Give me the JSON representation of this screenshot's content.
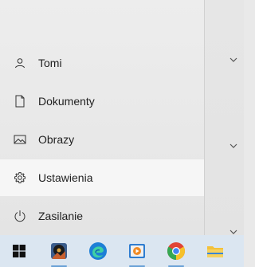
{
  "start_menu": {
    "items": [
      {
        "label": "Tomi",
        "icon": "user-icon",
        "active": false
      },
      {
        "label": "Dokumenty",
        "icon": "document-icon",
        "active": false
      },
      {
        "label": "Obrazy",
        "icon": "pictures-icon",
        "active": false
      },
      {
        "label": "Ustawienia",
        "icon": "gear-icon",
        "active": true
      },
      {
        "label": "Zasilanie",
        "icon": "power-icon",
        "active": false
      }
    ]
  },
  "right_panel": {
    "chevrons": [
      "chevron-down-icon",
      "chevron-down-icon",
      "chevron-down-icon"
    ]
  },
  "taskbar": {
    "icons": [
      "windows-start-icon",
      "media-app-icon",
      "edge-icon",
      "video-app-icon",
      "chrome-icon",
      "file-explorer-icon"
    ]
  },
  "colors": {
    "taskbar_bg": "#dbe6f1",
    "hover_item_bg": "#f6f6f6",
    "windows_blue": "#1f6fb4",
    "edge_blue": "#1d7fd6",
    "chrome_red": "#e14436",
    "chrome_yellow": "#f6c12b",
    "chrome_green": "#35a853",
    "chrome_blue": "#4285f4",
    "explorer_yellow": "#f3c13a"
  }
}
